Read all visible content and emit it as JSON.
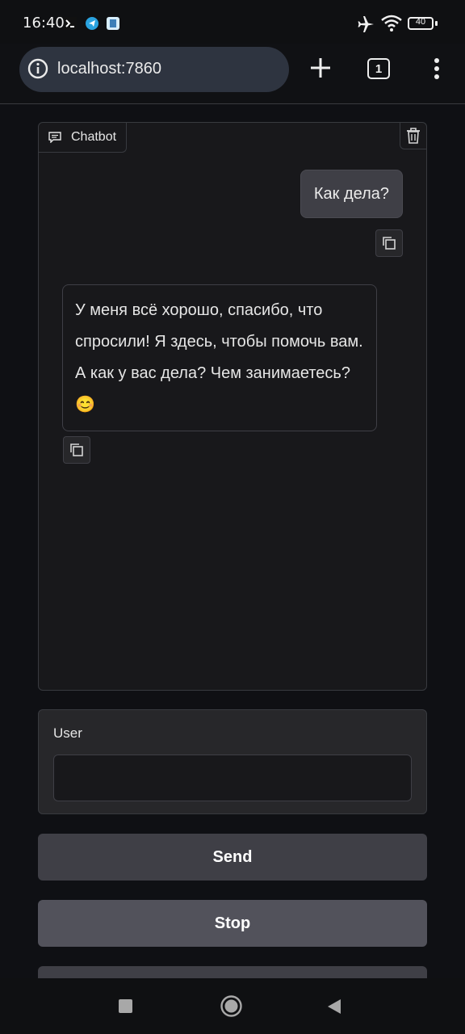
{
  "status_bar": {
    "time": "16:40",
    "battery": "40",
    "icons": [
      "terminal-icon",
      "telegram-icon",
      "app-icon",
      "airplane-mode-icon",
      "wifi-icon",
      "battery-icon"
    ]
  },
  "browser": {
    "url": "localhost:7860",
    "tab_count": "1",
    "icons": [
      "site-info-icon",
      "new-tab-icon",
      "tab-switcher-icon",
      "more-menu-icon"
    ]
  },
  "chatbot": {
    "label": "Chatbot",
    "messages": [
      {
        "role": "user",
        "text": "Как дела?"
      },
      {
        "role": "bot",
        "text": "У меня всё хорошо, спасибо, что спросили! Я здесь, чтобы помочь вам. А как у вас дела? Чем занимаетесь? 😊"
      }
    ]
  },
  "input": {
    "label": "User",
    "value": "",
    "placeholder": ""
  },
  "buttons": {
    "send": "Send",
    "stop": "Stop"
  },
  "colors": {
    "background": "#0f1014",
    "panel": "#18181b",
    "user_bubble": "#3f3f46",
    "send_button": "#3f3f46",
    "stop_button": "#52525b"
  }
}
